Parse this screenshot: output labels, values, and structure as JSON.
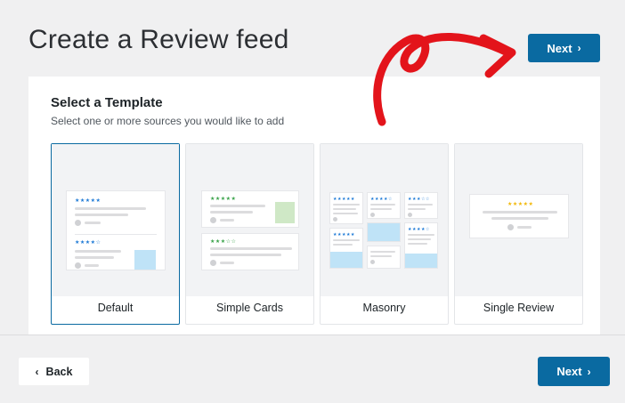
{
  "page": {
    "title": "Create a Review feed"
  },
  "top_button": {
    "label": "Next"
  },
  "section": {
    "title": "Select a Template",
    "subtitle": "Select one or more sources you would like to add"
  },
  "templates": [
    {
      "label": "Default",
      "selected": true
    },
    {
      "label": "Simple Cards",
      "selected": false
    },
    {
      "label": "Masonry",
      "selected": false
    },
    {
      "label": "Single Review",
      "selected": false
    }
  ],
  "footer": {
    "back_label": "Back",
    "next_label": "Next"
  },
  "colors": {
    "primary": "#0a6aa1",
    "star_blue": "#1e7ad6",
    "star_green": "#3aa34a",
    "star_yellow": "#f2b705",
    "annotation_red": "#e3141b"
  },
  "icons": {
    "next": "chevron-right-icon",
    "back": "chevron-left-icon"
  }
}
